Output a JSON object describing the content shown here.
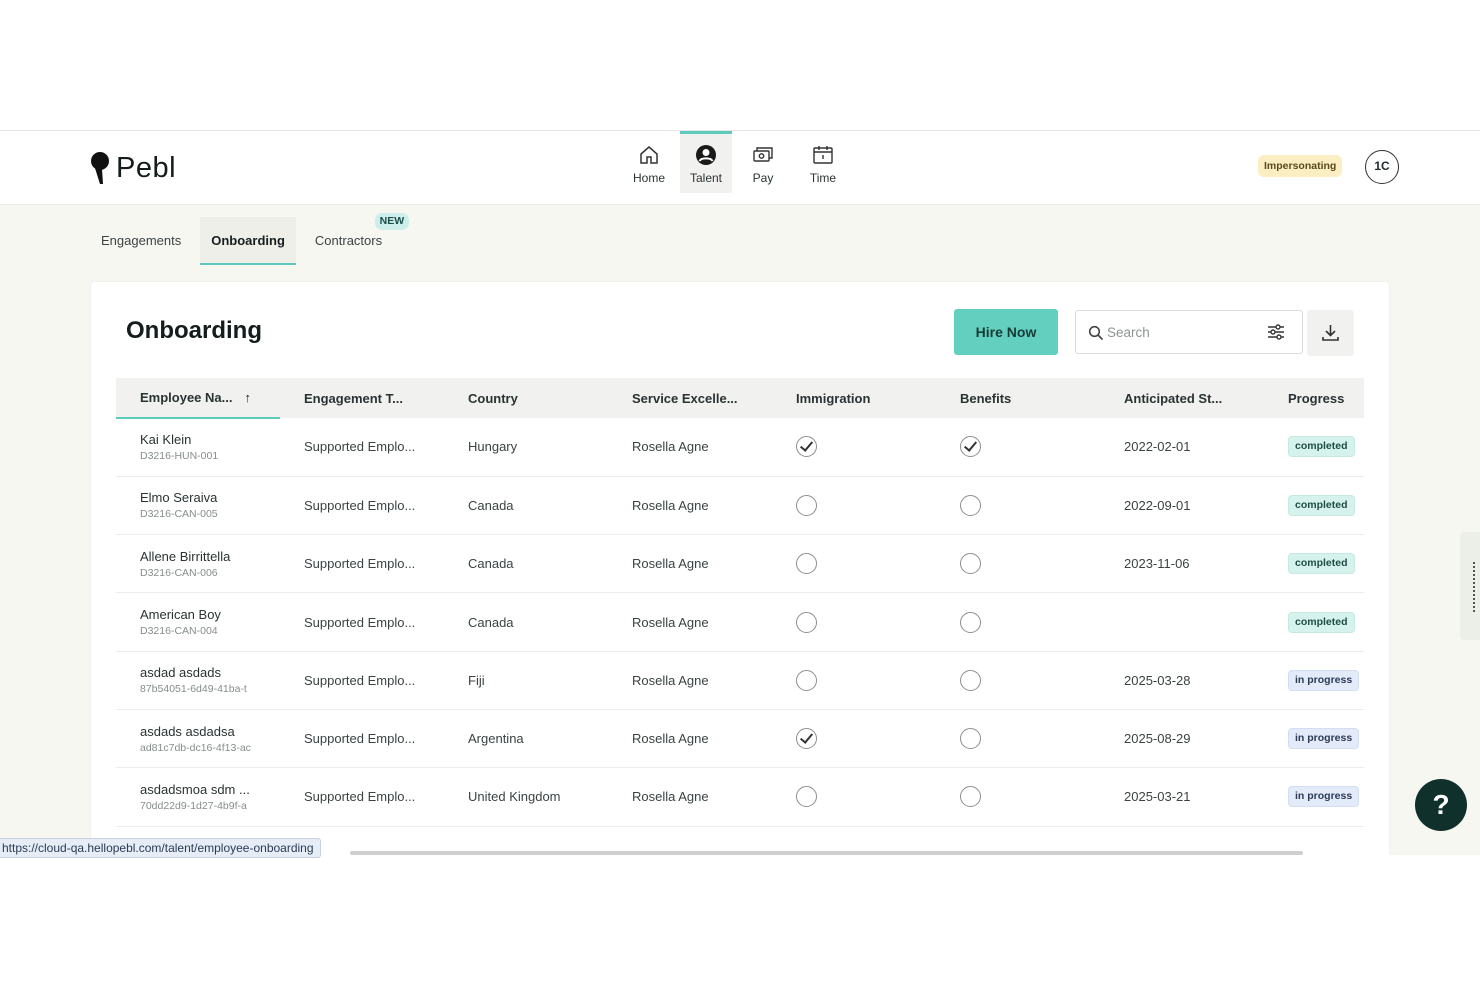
{
  "brand": {
    "name": "Pebl"
  },
  "nav": [
    {
      "label": "Home",
      "icon": "home-icon"
    },
    {
      "label": "Talent",
      "icon": "talent-icon",
      "active": true
    },
    {
      "label": "Pay",
      "icon": "pay-icon"
    },
    {
      "label": "Time",
      "icon": "time-icon"
    }
  ],
  "header": {
    "impersonating_label": "Impersonating",
    "avatar_initials": "1C"
  },
  "subtabs": [
    {
      "label": "Engagements"
    },
    {
      "label": "Onboarding",
      "active": true
    },
    {
      "label": "Contractors",
      "badge": "NEW"
    }
  ],
  "card": {
    "title": "Onboarding",
    "hire_button": "Hire Now",
    "search_placeholder": "Search"
  },
  "table": {
    "columns": [
      "Employee Na...",
      "Engagement T...",
      "Country",
      "Service Excelle...",
      "Immigration",
      "Benefits",
      "Anticipated St...",
      "Progress"
    ],
    "sort_column": "Employee Na...",
    "rows": [
      {
        "name": "Kai Klein",
        "id": "D3216-HUN-001",
        "engagement": "Supported Emplo...",
        "country": "Hungary",
        "service": "Rosella Agne",
        "immigration": true,
        "benefits": true,
        "start": "2022-02-01",
        "progress": "completed"
      },
      {
        "name": "Elmo Seraiva",
        "id": "D3216-CAN-005",
        "engagement": "Supported Emplo...",
        "country": "Canada",
        "service": "Rosella Agne",
        "immigration": false,
        "benefits": false,
        "start": "2022-09-01",
        "progress": "completed"
      },
      {
        "name": "Allene Birrittella",
        "id": "D3216-CAN-006",
        "engagement": "Supported Emplo...",
        "country": "Canada",
        "service": "Rosella Agne",
        "immigration": false,
        "benefits": false,
        "start": "2023-11-06",
        "progress": "completed"
      },
      {
        "name": "American Boy",
        "id": "D3216-CAN-004",
        "engagement": "Supported Emplo...",
        "country": "Canada",
        "service": "Rosella Agne",
        "immigration": false,
        "benefits": false,
        "start": "",
        "progress": "completed"
      },
      {
        "name": "asdad asdads",
        "id": "87b54051-6d49-41ba-t",
        "engagement": "Supported Emplo...",
        "country": "Fiji",
        "service": "Rosella Agne",
        "immigration": false,
        "benefits": false,
        "start": "2025-03-28",
        "progress": "in progress"
      },
      {
        "name": "asdads asdadsa",
        "id": "ad81c7db-dc16-4f13-ac",
        "engagement": "Supported Emplo...",
        "country": "Argentina",
        "service": "Rosella Agne",
        "immigration": true,
        "benefits": false,
        "start": "2025-08-29",
        "progress": "in progress"
      },
      {
        "name": "asdadsmoa sdm ...",
        "id": "70dd22d9-1d27-4b9f-a",
        "engagement": "Supported Emplo...",
        "country": "United Kingdom",
        "service": "Rosella Agne",
        "immigration": false,
        "benefits": false,
        "start": "2025-03-21",
        "progress": "in progress"
      }
    ]
  },
  "status_url": "https://cloud-qa.hellopebl.com/talent/employee-onboarding",
  "colors": {
    "accent": "#5ccbbb",
    "hire": "#63d0bf",
    "help": "#10302c"
  }
}
